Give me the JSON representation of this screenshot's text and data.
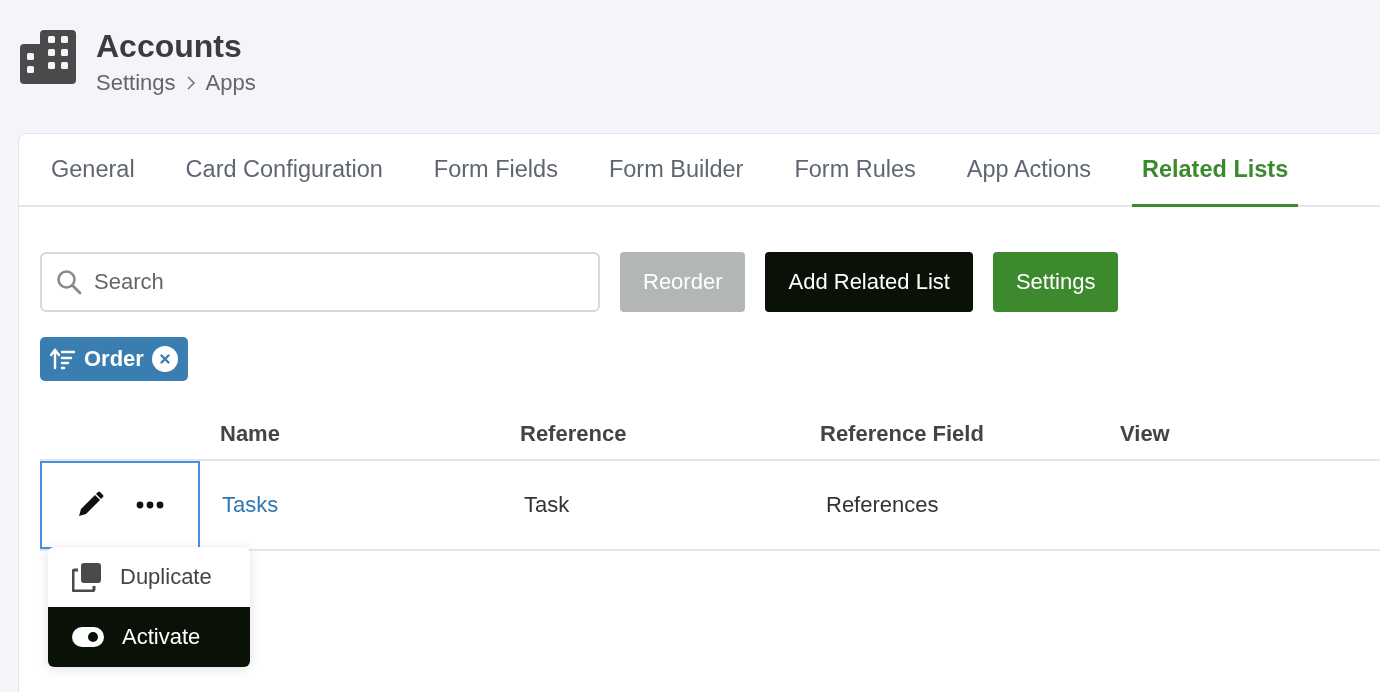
{
  "header": {
    "title": "Accounts",
    "breadcrumb": [
      "Settings",
      "Apps"
    ]
  },
  "tabs": [
    {
      "label": "General",
      "selected": false
    },
    {
      "label": "Card Configuration",
      "selected": false
    },
    {
      "label": "Form Fields",
      "selected": false
    },
    {
      "label": "Form Builder",
      "selected": false
    },
    {
      "label": "Form Rules",
      "selected": false
    },
    {
      "label": "App Actions",
      "selected": false
    },
    {
      "label": "Related Lists",
      "selected": true
    }
  ],
  "search": {
    "placeholder": "Search"
  },
  "buttons": [
    {
      "label": "Reorder",
      "kind": "disabled"
    },
    {
      "label": "Add Related List",
      "kind": "primary"
    },
    {
      "label": "Settings",
      "kind": "success"
    }
  ],
  "filter_chip": {
    "label": "Order"
  },
  "table": {
    "columns": [
      "Name",
      "Reference",
      "Reference Field",
      "View"
    ],
    "rows": [
      {
        "name": "Tasks",
        "reference": "Task",
        "reference_field": "References",
        "actions_focused": true
      }
    ]
  },
  "row_menu": {
    "items": [
      {
        "label": "Duplicate",
        "kind": "duplicate",
        "selected": false
      },
      {
        "label": "Activate",
        "kind": "toggle",
        "selected": true
      }
    ]
  }
}
